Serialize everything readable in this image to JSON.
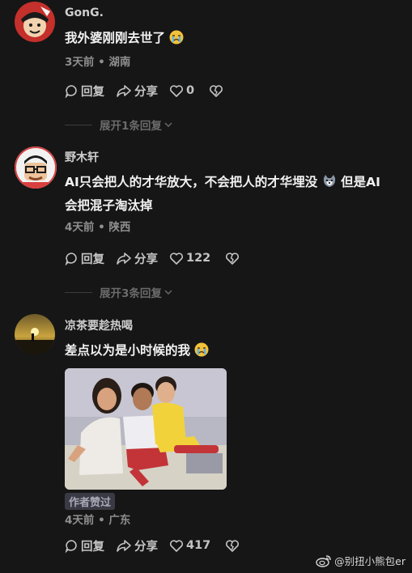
{
  "comments": [
    {
      "username": "GonG.",
      "text": "我外婆刚刚去世了",
      "meta": "3天前 • 湖南",
      "reply_label": "回复",
      "share_label": "分享",
      "like_count": "0",
      "expand_label": "展开1条回复"
    },
    {
      "username": "野木轩",
      "text_line1": "AI只会把人的才华放大，不会把人的才华埋没",
      "text_line1_suffix": "但是AI",
      "text_line2": "会把混子淘汰掉",
      "meta": "4天前 • 陕西",
      "reply_label": "回复",
      "share_label": "分享",
      "like_count": "122",
      "expand_label": "展开3条回复"
    },
    {
      "username": "凉茶要趁热喝",
      "text": "差点以为是小时候的我",
      "badge": "作者赞过",
      "meta": "4天前 • 广东",
      "reply_label": "回复",
      "share_label": "分享",
      "like_count": "417"
    }
  ],
  "watermark": "@别扭小熊包er",
  "icons": {
    "reply": "comment-bubble-icon",
    "share": "share-arrow-icon",
    "like": "heart-icon",
    "dislike": "broken-heart-icon",
    "expand": "chevron-down-icon"
  }
}
